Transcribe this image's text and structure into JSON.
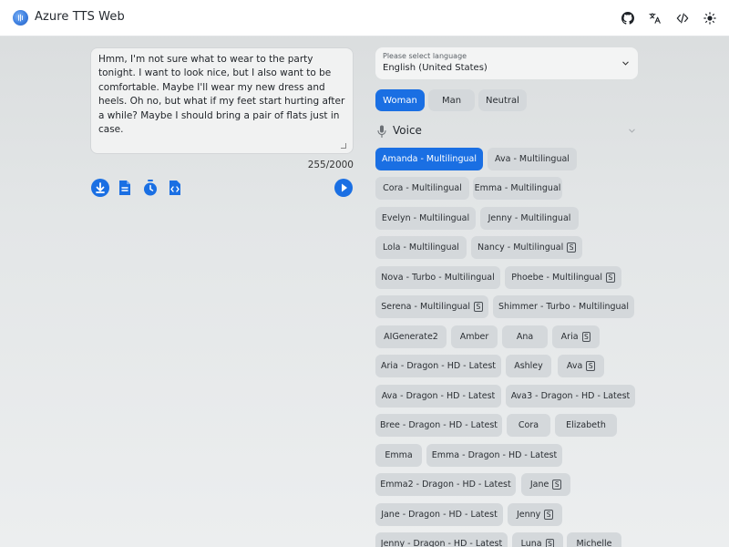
{
  "app": {
    "title": "Azure TTS Web"
  },
  "toolbar": {
    "icons": [
      "github-icon",
      "translate-icon",
      "code-icon",
      "theme-sun-icon"
    ]
  },
  "editor": {
    "text": "Hmm, I'm not sure what to wear to the party tonight. I want to look nice, but I also want to be comfortable. Maybe I'll wear my new dress and heels. Oh no, but what if my feet start hurting after a while? Maybe I should bring a pair of flats just in case.",
    "char_count": "255/2000"
  },
  "actions": [
    "download-icon",
    "document-icon",
    "timer-icon",
    "code-file-icon",
    "play-icon"
  ],
  "language": {
    "label": "Please select language",
    "value": "English (United States)"
  },
  "gender": {
    "options": [
      "Woman",
      "Man",
      "Neutral"
    ],
    "selected": "Woman"
  },
  "voice_section": {
    "title": "Voice"
  },
  "voices": [
    {
      "name": "Amanda - Multilingual",
      "selected": true,
      "s": false
    },
    {
      "name": "Ava - Multilingual",
      "s": false
    },
    {
      "name": "Cora - Multilingual",
      "s": false
    },
    {
      "name": "Emma - Multilingual",
      "s": false
    },
    {
      "name": "Evelyn - Multilingual",
      "s": false
    },
    {
      "name": "Jenny - Multilingual",
      "s": false
    },
    {
      "name": "Lola - Multilingual",
      "s": false
    },
    {
      "name": "Nancy - Multilingual",
      "s": true
    },
    {
      "name": "Nova - Turbo - Multilingual",
      "s": false
    },
    {
      "name": "Phoebe - Multilingual",
      "s": true
    },
    {
      "name": "Serena - Multilingual",
      "s": true
    },
    {
      "name": "Shimmer - Turbo - Multilingual",
      "s": false
    },
    {
      "name": "AIGenerate2",
      "s": false
    },
    {
      "name": "Amber",
      "s": false
    },
    {
      "name": "Ana",
      "s": false
    },
    {
      "name": "Aria",
      "s": true
    },
    {
      "name": "Aria - Dragon - HD - Latest",
      "s": false
    },
    {
      "name": "Ashley",
      "s": false
    },
    {
      "name": "Ava",
      "s": true
    },
    {
      "name": "Ava - Dragon - HD - Latest",
      "s": false
    },
    {
      "name": "Ava3 - Dragon - HD - Latest",
      "s": false
    },
    {
      "name": "Bree - Dragon - HD - Latest",
      "s": false
    },
    {
      "name": "Cora",
      "s": false
    },
    {
      "name": "Elizabeth",
      "s": false
    },
    {
      "name": "Emma",
      "s": false
    },
    {
      "name": "Emma - Dragon - HD - Latest",
      "s": false
    },
    {
      "name": "Emma2 - Dragon - HD - Latest",
      "s": false
    },
    {
      "name": "Jane",
      "s": true
    },
    {
      "name": "Jane - Dragon - HD - Latest",
      "s": false
    },
    {
      "name": "Jenny",
      "s": true
    },
    {
      "name": "Jenny - Dragon - HD - Latest",
      "s": false
    },
    {
      "name": "Luna",
      "s": true
    },
    {
      "name": "Michelle",
      "s": false
    }
  ],
  "colors": {
    "accent": "#1a6fe3",
    "chip": "#d4d8db"
  }
}
